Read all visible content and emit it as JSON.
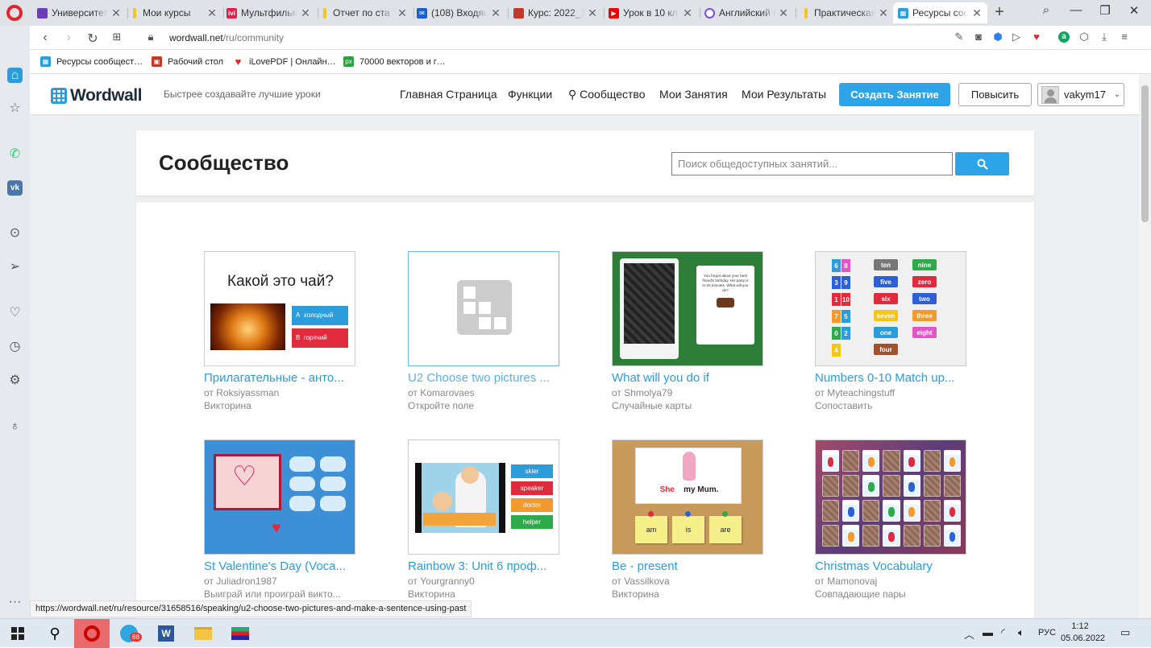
{
  "tabs": [
    {
      "title": "Университет",
      "icon": "university-icon",
      "color": "#6a3fb5"
    },
    {
      "title": "Мои курсы",
      "icon": "bookmark-yellow-icon",
      "color": "#f5c518"
    },
    {
      "title": "Мультфильм",
      "icon": "ivi-icon",
      "color": "#e0204a"
    },
    {
      "title": "Отчет по ста",
      "icon": "bookmark-yellow-icon",
      "color": "#f5c518"
    },
    {
      "title": "(108) Входящ",
      "icon": "mail-icon",
      "color": "#1d5fd1"
    },
    {
      "title": "Курс: 2022_1",
      "icon": "course-icon",
      "color": "#c0392b"
    },
    {
      "title": "Урок в 10 кл",
      "icon": "youtube-icon",
      "color": "#e00"
    },
    {
      "title": "Английский к",
      "icon": "circle-purple-icon",
      "color": "#7b4fd6"
    },
    {
      "title": "Практическая",
      "icon": "bookmark-yellow-icon",
      "color": "#f5c518"
    },
    {
      "title": "Ресурсы сооб",
      "icon": "wordwall-icon",
      "color": "#2d9cdb"
    }
  ],
  "address_bar": {
    "domain": "wordwall.net",
    "path": "/ru/community"
  },
  "bookmarks": [
    {
      "label": "Ресурсы сообщест…",
      "color": "#2d9cdb"
    },
    {
      "label": "Рабочий стол",
      "color": "#c0392b"
    },
    {
      "label": "iLovePDF | Онлайн…",
      "color": "#e02424"
    },
    {
      "label": "70000 векторов и г…",
      "color": "#2f9e44"
    }
  ],
  "wordwall": {
    "logo": "Wordwall",
    "tagline": "Быстрее создавайте лучшие уроки",
    "nav": [
      "Главная Страница",
      "Функции",
      "Сообщество",
      "Мои Занятия",
      "Мои Результаты"
    ],
    "create_label": "Создать Занятие",
    "upgrade_label": "Повысить",
    "username": "vakym17"
  },
  "community": {
    "title": "Сообщество",
    "search_placeholder": "Поиск общедоступных занятий..."
  },
  "cards": [
    {
      "title": "Прилагательные - анто...",
      "author": "от Roksiyassman",
      "type": "Викторина"
    },
    {
      "title": "U2 Choose two pictures ...",
      "author": "от Komarovaes",
      "type": "Откройте поле"
    },
    {
      "title": "What will you do if",
      "author": "от Shmolya79",
      "type": "Случайные карты"
    },
    {
      "title": "Numbers 0-10 Match up...",
      "author": "от Myteachingstuff",
      "type": "Сопоставить"
    },
    {
      "title": "St Valentine's Day (Voca...",
      "author": "от Juliadron1987",
      "type": "Выиграй или проиграй викто..."
    },
    {
      "title": "Rainbow 3: Unit 6 проф...",
      "author": "от Yourgranny0",
      "type": "Викторина"
    },
    {
      "title": "Be - present",
      "author": "от Vassilkova",
      "type": "Викторина"
    },
    {
      "title": "Christmas Vocabulary",
      "author": "от Mamonovaj",
      "type": "Совпадающие пары"
    }
  ],
  "thumbs": {
    "tea": {
      "question": "Какой это чай?",
      "a1": "холодный",
      "a2": "горячий"
    },
    "card": {
      "text": "You forgot about your best friend's birthday. His party is in 20 minutes. What will you do?"
    },
    "numbers": {
      "digits": [
        "6",
        "8",
        "3",
        "9",
        "1",
        "10",
        "7",
        "5",
        "0",
        "2",
        "4"
      ],
      "words": [
        "ten",
        "nine",
        "five",
        "zero",
        "six",
        "two",
        "seven",
        "three",
        "one",
        "eight",
        "four"
      ]
    },
    "rainbow": {
      "labels": [
        "skier",
        "speaker",
        "doctor",
        "helper"
      ]
    },
    "present": {
      "she": "She",
      "rest": "my Mum.",
      "words": [
        "am",
        "is",
        "are"
      ]
    }
  },
  "status_url": "https://wordwall.net/ru/resource/31658516/speaking/u2-choose-two-pictures-and-make-a-sentence-using-past",
  "taskbar": {
    "lang": "РУС",
    "time": "1:12",
    "date": "05.06.2022",
    "telegram_badge": "68"
  }
}
